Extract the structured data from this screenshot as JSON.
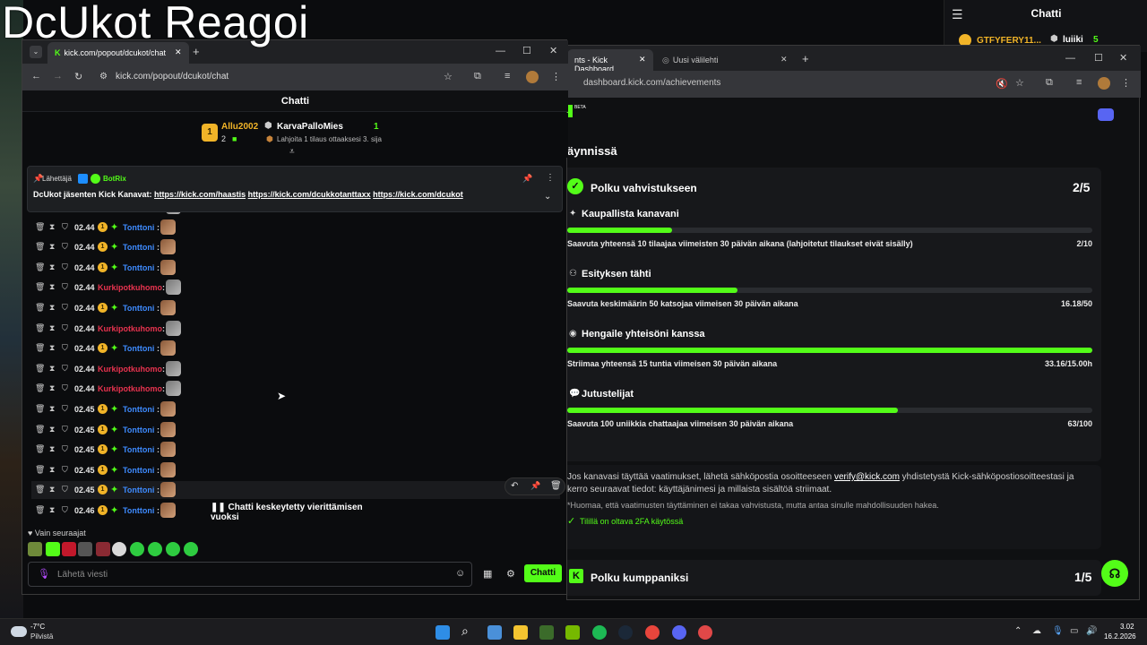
{
  "overlay": {
    "title": "DcUkot Reagoi"
  },
  "bg_chat": {
    "title": "Chatti",
    "leader1": "GTFYFERY11...",
    "leader2": "luiiki",
    "leader2_count": "5"
  },
  "dashboard_window": {
    "tab1": "nts - Kick Dashboard",
    "tab2": "Uusi välilehti",
    "url": "dashboard.kick.com/achievements",
    "section_title": "äynnissä",
    "path1": {
      "title": "Polku vahvistukseen",
      "progress": "2/5"
    },
    "goals": [
      {
        "title": "Kaupallista kanavani",
        "desc": "Saavuta yhteensä 10 tilaajaa viimeisten 30 päivän aikana (lahjoitetut tilaukset eivät sisälly)",
        "value": "2/10",
        "fraction": 0.2
      },
      {
        "title": "Esityksen tähti",
        "desc": "Saavuta keskimäärin 50 katsojaa viimeisen 30 päivän aikana",
        "value": "16.18/50",
        "fraction": 0.3236
      },
      {
        "title": "Hengaile yhteisöni kanssa",
        "desc": "Striimaa yhteensä 15 tuntia viimeisen 30 päivän aikana",
        "value": "33.16/15.00h",
        "fraction": 1.0
      },
      {
        "title": "Jutustelijat",
        "desc": "Saavuta 100 uniikkia chattaajaa viimeisen 30 päivän aikana",
        "value": "63/100",
        "fraction": 0.63
      }
    ],
    "info_pre": "Jos kanavasi täyttää vaatimukset, lähetä sähköpostia osoitteeseen ",
    "info_email": "verify@kick.com",
    "info_post": " yhdistetystä Kick-sähköpostiosoitteestasi ja",
    "info_line2": "kerro seuraavat tiedot: käyttäjänimesi ja millaista sisältöä striimaat.",
    "note": "*Huomaa, että vaatimusten täyttäminen ei takaa vahvistusta, mutta antaa sinulle mahdollisuuden hakea.",
    "twofa": "Tilillä on oltava 2FA käytössä",
    "path2": {
      "title": "Polku kumppaniksi",
      "progress": "1/5"
    },
    "beta": "BETA"
  },
  "chat_window": {
    "tab_title": "kick.com/popout/dcukot/chat",
    "url": "kick.com/popout/dcukot/chat",
    "header": "Chatti",
    "leaderboard": {
      "first_name": "Allu2002",
      "first_count": "2",
      "second_name": "KarvaPalloMies",
      "second_count": "1",
      "gift_hint": "Lahjoita 1 tilaus ottaaksesi 3. sija"
    },
    "pinned": {
      "sender_label": "Lähettäjä",
      "sender": "BotRix",
      "text": "DcUkot jäsenten Kick Kanavat: ",
      "link1": "https://kick.com/haastis",
      "link2": "https://kick.com/dcukkotanttaxx",
      "link3": "https://kick.com/dcukot"
    },
    "messages": [
      {
        "time": "02.44",
        "user": "Kurkipotkuhomo",
        "kind": "red"
      },
      {
        "time": "02.44",
        "user": "Tonttoni",
        "kind": "blue"
      },
      {
        "time": "02.44",
        "user": "Tonttoni",
        "kind": "blue"
      },
      {
        "time": "02.44",
        "user": "Tonttoni",
        "kind": "blue"
      },
      {
        "time": "02.44",
        "user": "Kurkipotkuhomo",
        "kind": "red"
      },
      {
        "time": "02.44",
        "user": "Tonttoni",
        "kind": "blue"
      },
      {
        "time": "02.44",
        "user": "Kurkipotkuhomo",
        "kind": "red"
      },
      {
        "time": "02.44",
        "user": "Tonttoni",
        "kind": "blue"
      },
      {
        "time": "02.44",
        "user": "Kurkipotkuhomo",
        "kind": "red"
      },
      {
        "time": "02.44",
        "user": "Kurkipotkuhomo",
        "kind": "red"
      },
      {
        "time": "02.45",
        "user": "Tonttoni",
        "kind": "blue"
      },
      {
        "time": "02.45",
        "user": "Tonttoni",
        "kind": "blue"
      },
      {
        "time": "02.45",
        "user": "Tonttoni",
        "kind": "blue"
      },
      {
        "time": "02.45",
        "user": "Tonttoni",
        "kind": "blue"
      },
      {
        "time": "02.45",
        "user": "Tonttoni",
        "kind": "blue"
      },
      {
        "time": "02.46",
        "user": "Tonttoni",
        "kind": "blue"
      }
    ],
    "pause_text": "Chatti keskeytetty vierittämisen vuoksi",
    "followers_only": "Vain seuraajat",
    "input_placeholder": "Lähetä viesti",
    "send_label": "Chatti"
  },
  "taskbar": {
    "weather_temp": "-7°C",
    "weather_desc": "Pilvistä",
    "time": "3.02",
    "date": "16.2.2026"
  },
  "colors": {
    "kick_green": "#53fc18",
    "user_red": "#e8334f",
    "user_blue": "#3e8bff",
    "gold": "#f1b428"
  }
}
